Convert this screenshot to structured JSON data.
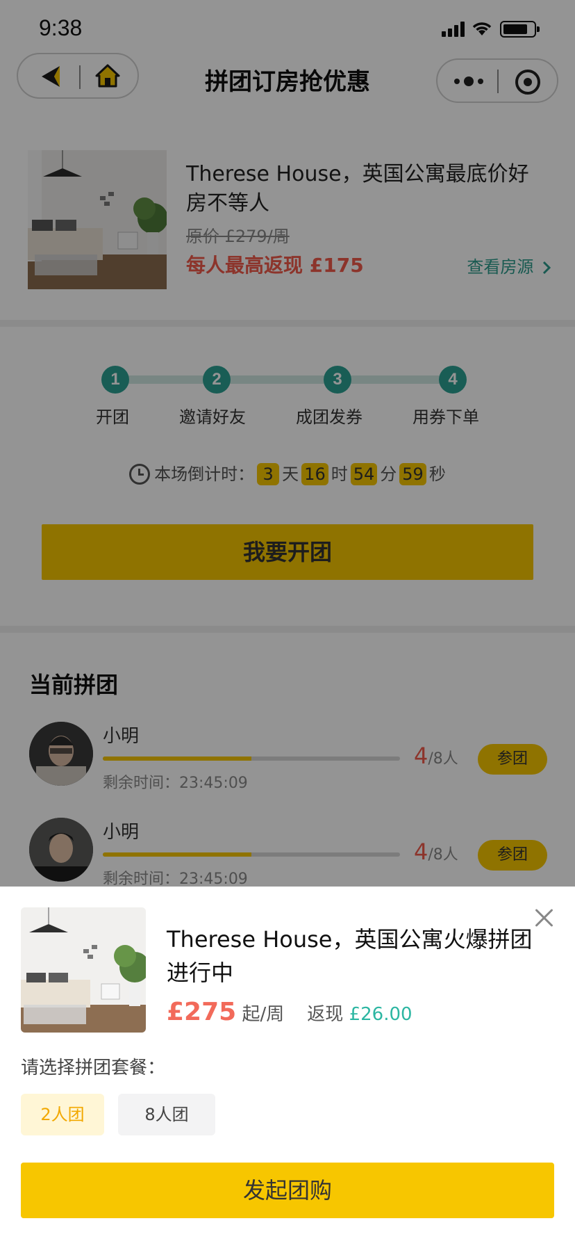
{
  "status_bar": {
    "time": "9:38"
  },
  "nav": {
    "title": "拼团订房抢优惠"
  },
  "product": {
    "title": "Therese House，英国公寓最底价好房不等人",
    "original_price": "原价 £279/周",
    "cashback": "每人最高返现 £175",
    "view_link": "查看房源"
  },
  "steps": [
    {
      "num": "1",
      "label": "开团"
    },
    {
      "num": "2",
      "label": "邀请好友"
    },
    {
      "num": "3",
      "label": "成团发券"
    },
    {
      "num": "4",
      "label": "用券下单"
    }
  ],
  "countdown": {
    "prefix": "本场倒计时：",
    "days": "3",
    "days_unit": "天",
    "hours": "16",
    "hours_unit": "时",
    "minutes": "54",
    "minutes_unit": "分",
    "seconds": "59",
    "seconds_unit": "秒"
  },
  "open_button": "我要开团",
  "groups": {
    "title": "当前拼团",
    "items": [
      {
        "name": "小明",
        "remaining": "剩余时间：23:45:09",
        "count": "4",
        "total": "/8人",
        "progress": 0.5,
        "join": "参团"
      },
      {
        "name": "小明",
        "remaining": "剩余时间：23:45:09",
        "count": "4",
        "total": "/8人",
        "progress": 0.5,
        "join": "参团"
      }
    ]
  },
  "sheet": {
    "title": "Therese House，英国公寓火爆拼团进行中",
    "price": "£275",
    "price_unit": "起/周",
    "cashback_label": "返现",
    "cashback_value": "£26.00",
    "choose_label": "请选择拼团套餐：",
    "options": [
      {
        "label": "2人团"
      },
      {
        "label": "8人团"
      }
    ],
    "submit": "发起团购"
  },
  "colors": {
    "accent": "#f7c600",
    "teal": "#2ca193",
    "red": "#f25a4a"
  }
}
